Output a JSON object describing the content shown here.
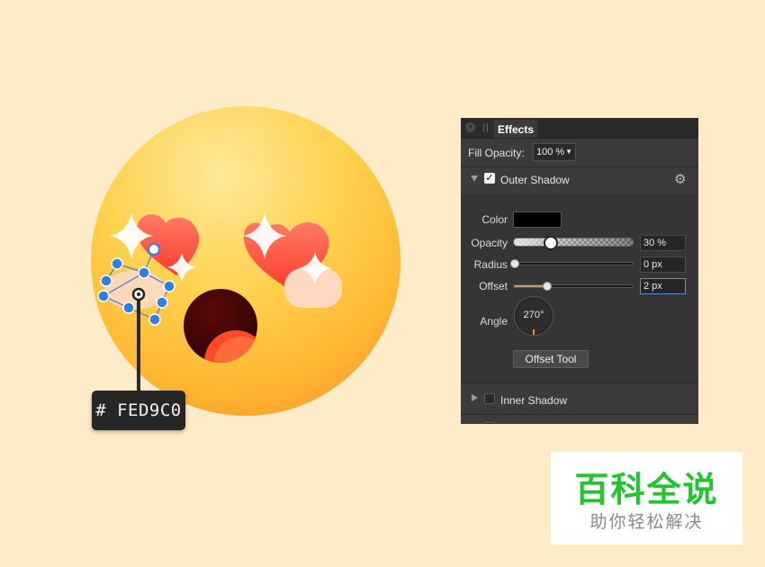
{
  "canvas": {
    "background_color": "#feebc8",
    "color_tag": "# FED9C0"
  },
  "effects_panel": {
    "tab_label": "Effects",
    "fill_opacity_label": "Fill Opacity:",
    "fill_opacity_value": "100 %",
    "outer_shadow": {
      "label": "Outer Shadow",
      "checked": true,
      "color_label": "Color",
      "color_value": "#000000",
      "opacity_label": "Opacity",
      "opacity_value": "30 %",
      "opacity_fraction": 0.3,
      "radius_label": "Radius",
      "radius_value": "0 px",
      "radius_fraction": 0.0,
      "offset_label": "Offset",
      "offset_value": "2 px",
      "offset_fraction": 0.27,
      "angle_label": "Angle",
      "angle_value": "270°",
      "offset_tool_label": "Offset Tool"
    },
    "inner_shadow": {
      "label": "Inner Shadow",
      "checked": false
    },
    "icons": {
      "close": "close-icon",
      "settings": "gear-icon",
      "expand": "disclosure-triangle-icon"
    }
  },
  "watermark": {
    "title": "百科全说",
    "subtitle": "助你轻松解决"
  }
}
